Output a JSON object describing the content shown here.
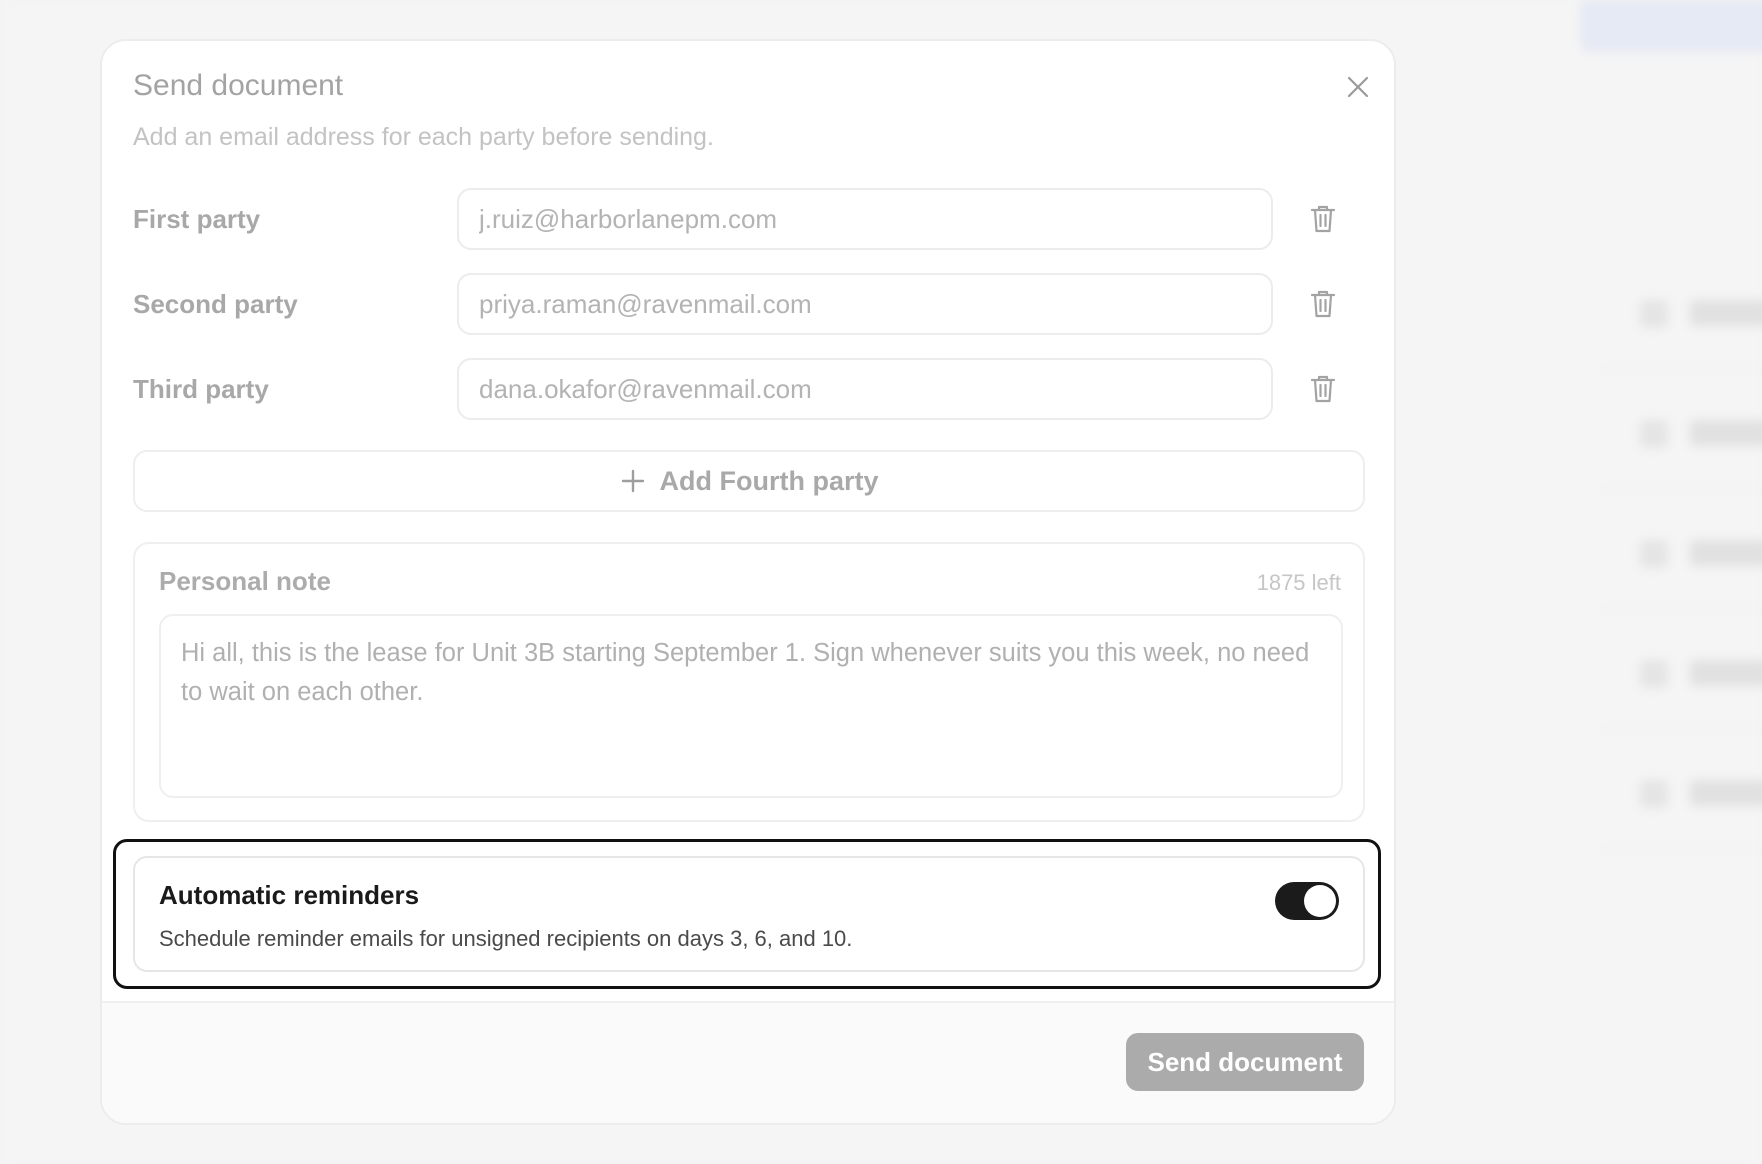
{
  "modal": {
    "title": "Send document",
    "subtitle": "Add an email address for each party before sending.",
    "close_icon": "close-icon"
  },
  "parties": [
    {
      "label": "First party",
      "email": "j.ruiz@harborlanepm.com"
    },
    {
      "label": "Second party",
      "email": "priya.raman@ravenmail.com"
    },
    {
      "label": "Third party",
      "email": "dana.okafor@ravenmail.com"
    }
  ],
  "add_party": {
    "label": "Add Fourth party",
    "icon": "plus-icon"
  },
  "note": {
    "label": "Personal note",
    "counter": "1875 left",
    "text": "Hi all, this is the lease for Unit 3B starting September 1. Sign whenever suits you this week, no need to wait on each other."
  },
  "reminders": {
    "title": "Automatic reminders",
    "description": "Schedule reminder emails for unsigned recipients on days 3, 6, and 10.",
    "enabled": true
  },
  "footer": {
    "send_label": "Send document"
  },
  "colors": {
    "toggle_on": "#1b1b1b",
    "send_button_disabled": "#ababab",
    "focus_ring": "#111111"
  }
}
